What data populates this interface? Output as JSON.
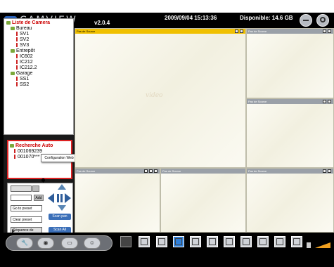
{
  "header": {
    "brand": "CAMVIEW",
    "version": "v2.0.4",
    "datetime": "2009/09/04 15:13:36",
    "disk": "Disponible: 14.6 GB",
    "minimize_icon": "minimize-icon",
    "power_icon": "power-icon"
  },
  "tree": {
    "root": "Liste de Camera",
    "groups": [
      {
        "name": "Bureau",
        "cameras": [
          "SV1",
          "SV2",
          "SV3"
        ]
      },
      {
        "name": "Entrepôt",
        "cameras": [
          "IC602",
          "IC212",
          "IC212.2"
        ]
      },
      {
        "name": "Garage",
        "cameras": [
          "SS1",
          "SS2"
        ]
      }
    ]
  },
  "auto_search": {
    "title": "Recherche Auto",
    "items": [
      "001069239",
      "001070***"
    ],
    "context_menu": "Configuration Web"
  },
  "ptz": {
    "add_label": "Add",
    "goto_preset": "Go to preset",
    "clear_preset": "Clear preset",
    "scan_pan": "Scan pan",
    "sequence": "Séquence de",
    "scan_all": "Scan All"
  },
  "video": {
    "no_source": "Pas de Source",
    "watermark": "video"
  },
  "layouts": [
    "1",
    "4",
    "6",
    "9",
    "10",
    "13",
    "16",
    "dual",
    "quad-wide",
    "fullscreen"
  ],
  "colors": {
    "accent": "#2f7fd8",
    "selected_header": "#f0c000",
    "search_border": "#d22"
  }
}
